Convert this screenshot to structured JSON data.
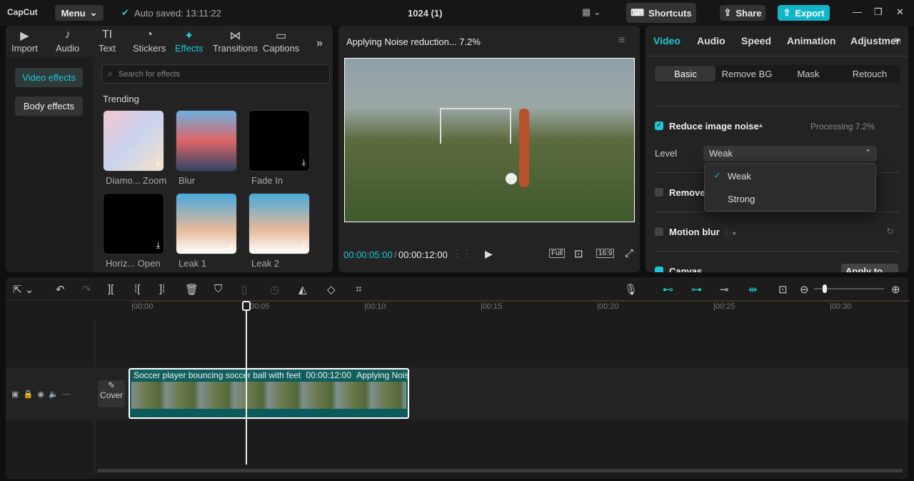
{
  "topbar": {
    "logo": "CapCut",
    "menu": "Menu",
    "autosave": "Auto saved: 13:11:22",
    "title": "1024 (1)",
    "shortcuts": "Shortcuts",
    "share": "Share",
    "export": "Export"
  },
  "media_tabs": [
    {
      "label": "Import",
      "icon": "▶"
    },
    {
      "label": "Audio",
      "icon": "♪"
    },
    {
      "label": "Text",
      "icon": "TI"
    },
    {
      "label": "Stickers",
      "icon": "◔"
    },
    {
      "label": "Effects",
      "icon": "✦"
    },
    {
      "label": "Transitions",
      "icon": "⋈"
    },
    {
      "label": "Captions",
      "icon": "▭"
    }
  ],
  "effects": {
    "side": [
      "Video effects",
      "Body effects"
    ],
    "search_placeholder": "Search for effects",
    "section": "Trending",
    "items": [
      {
        "label": "Diamo... Zoom"
      },
      {
        "label": "Blur"
      },
      {
        "label": "Fade In"
      },
      {
        "label": "Horiz... Open"
      },
      {
        "label": "Leak 1"
      },
      {
        "label": "Leak 2"
      }
    ]
  },
  "player": {
    "status": "Applying Noise reduction... 7.2%",
    "current": "00:00:05:00",
    "total": "00:00:12:00",
    "full": "Full",
    "ratio": "16:9"
  },
  "inspector": {
    "tabs": [
      "Video",
      "Audio",
      "Speed",
      "Animation",
      "Adjustment"
    ],
    "subtabs": [
      "Basic",
      "Remove BG",
      "Mask",
      "Retouch"
    ],
    "noise_label": "Reduce image noise",
    "processing": "Processing 7.2%",
    "level_label": "Level",
    "level_value": "Weak",
    "options": [
      "Weak",
      "Strong"
    ],
    "remove_label": "Remove",
    "motion_blur": "Motion blur",
    "canvas": "Canvas",
    "apply_all": "Apply to all"
  },
  "timeline": {
    "ticks": [
      "00:00",
      "00:05",
      "00:10",
      "00:15",
      "00:20",
      "00:25",
      "00:30"
    ],
    "clip_title": "Soccer player bouncing soccer ball with feet",
    "clip_duration": "00:00:12:00",
    "clip_status": "Applying Nois",
    "cover": "Cover"
  },
  "colors": {
    "accent": "#1fc7d4",
    "export": "#12b5c7"
  }
}
